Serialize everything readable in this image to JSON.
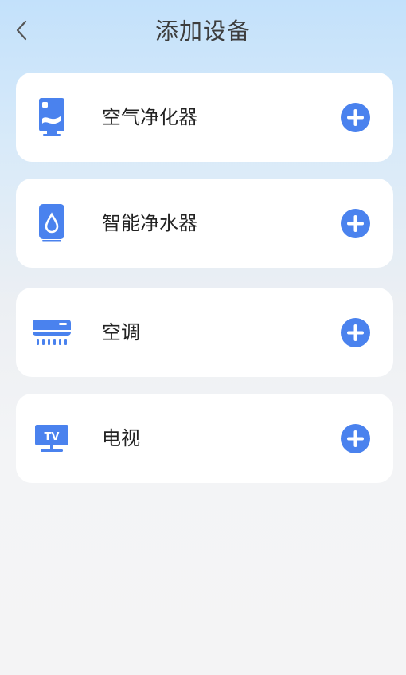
{
  "header": {
    "title": "添加设备",
    "back_icon": "chevron-left-icon"
  },
  "devices": [
    {
      "name": "空气净化器",
      "icon": "air-purifier-icon",
      "action_icon": "plus-circle-icon"
    },
    {
      "name": "智能净水器",
      "icon": "water-purifier-icon",
      "action_icon": "plus-circle-icon"
    },
    {
      "name": "空调",
      "icon": "air-conditioner-icon",
      "action_icon": "plus-circle-icon"
    },
    {
      "name": "电视",
      "icon": "tv-icon",
      "action_icon": "plus-circle-icon"
    }
  ],
  "colors": {
    "accent": "#4a82ee",
    "title_text": "#3d3d3d",
    "item_text": "#222222",
    "card_bg": "#ffffff"
  }
}
